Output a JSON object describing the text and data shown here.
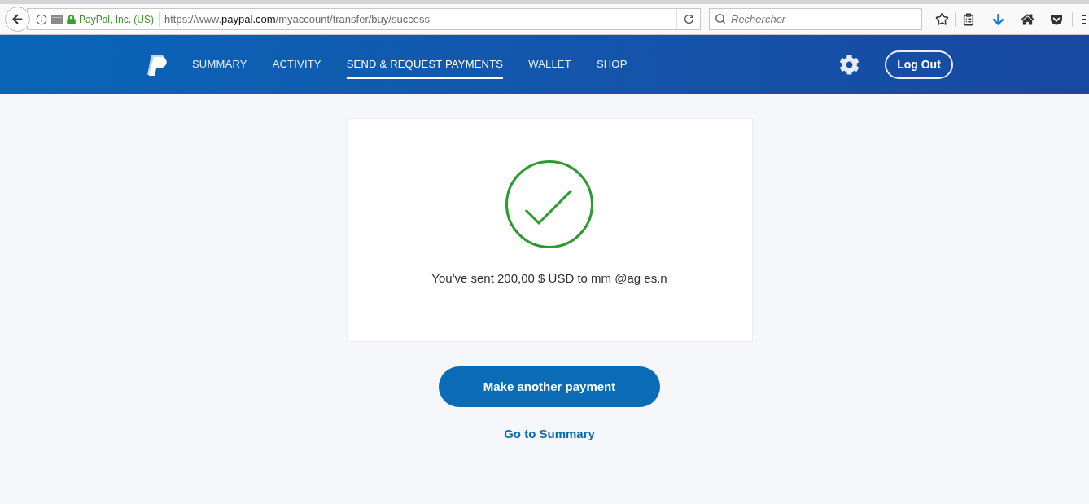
{
  "browser": {
    "site_identity": "PayPal, Inc. (US)",
    "url": {
      "prefix": "https://www.",
      "domain": "paypal.com",
      "path": "/myaccount/transfer/buy/success"
    },
    "search": {
      "placeholder": "Rechercher"
    }
  },
  "nav": {
    "items": [
      {
        "label": "SUMMARY",
        "selected": false
      },
      {
        "label": "ACTIVITY",
        "selected": false
      },
      {
        "label": "SEND & REQUEST PAYMENTS",
        "selected": true
      },
      {
        "label": "WALLET",
        "selected": false
      },
      {
        "label": "SHOP",
        "selected": false
      }
    ],
    "log_out": "Log Out"
  },
  "confirmation": {
    "message": "You've sent 200,00 $ USD to mm @ag es.n"
  },
  "actions": {
    "primary_button": "Make another payment",
    "link": "Go to Summary"
  }
}
